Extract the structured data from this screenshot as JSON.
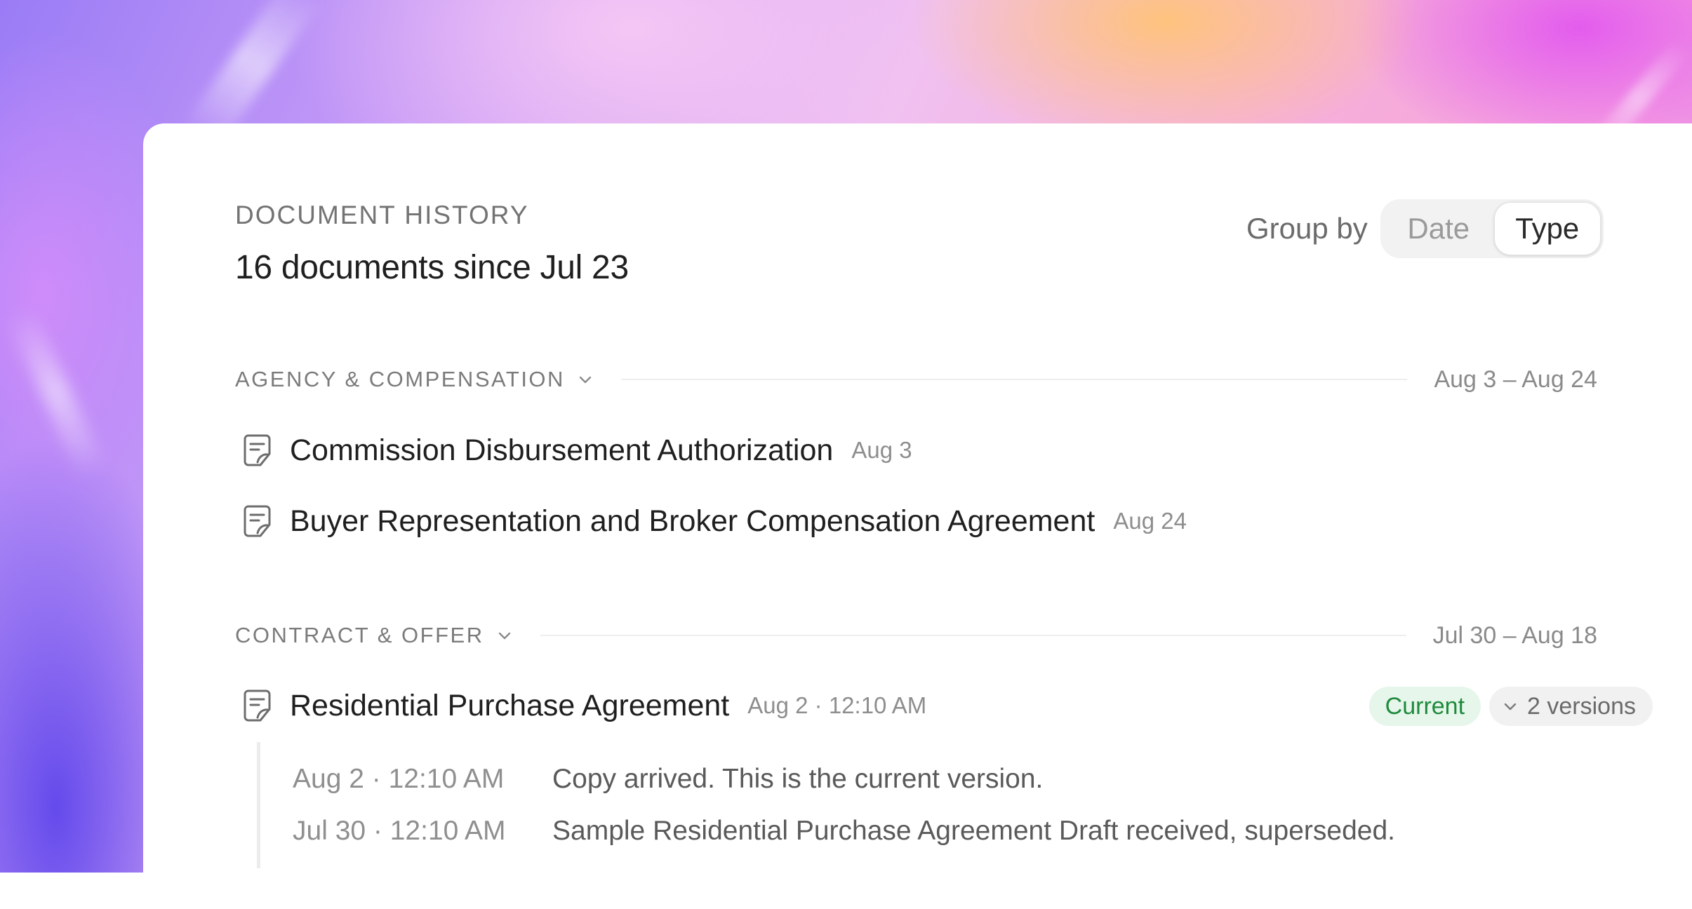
{
  "header": {
    "eyebrow": "DOCUMENT HISTORY",
    "title": "16 documents since Jul 23"
  },
  "group_by": {
    "label": "Group by",
    "options": [
      "Date",
      "Type"
    ],
    "selected": "Type"
  },
  "sections": [
    {
      "title": "AGENCY & COMPENSATION",
      "range": "Aug 3 – Aug 24",
      "documents": [
        {
          "title": "Commission Disbursement Authorization",
          "date": "Aug 3"
        },
        {
          "title": "Buyer Representation and Broker Compensation Agreement",
          "date": "Aug 24"
        }
      ]
    },
    {
      "title": "CONTRACT & OFFER",
      "range": "Jul 30 – Aug 18",
      "documents": [
        {
          "title": "Residential Purchase Agreement",
          "date": "Aug 2 · 12:10 AM",
          "status_badge": "Current",
          "versions_label": "2 versions",
          "versions": [
            {
              "time": "Aug 2 · 12:10 AM",
              "text": "Copy arrived. This is the current version."
            },
            {
              "time": "Jul 30 · 12:10 AM",
              "text": "Sample Residential Purchase Agreement Draft received, superseded."
            }
          ]
        }
      ]
    }
  ],
  "colors": {
    "badge_current_bg": "#e6f6ea",
    "badge_current_text": "#1e8a3c"
  },
  "icons": {
    "document": "document-signed-icon",
    "chevron": "chevron-down-icon"
  }
}
